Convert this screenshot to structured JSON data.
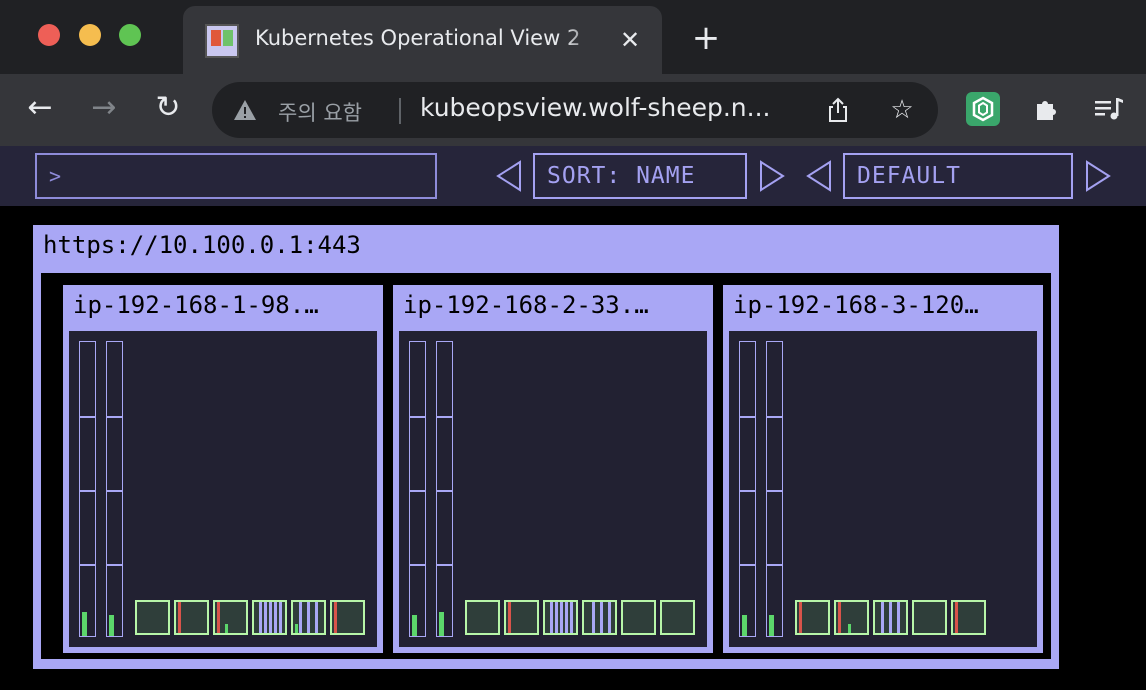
{
  "browser": {
    "tab_title": "Kubernetes Operational View 2",
    "tab_close": "✕",
    "new_tab": "+",
    "back": "←",
    "forward": "→",
    "reload": "↻",
    "security_warning": "주의 요함",
    "url": "kubeopsview.wolf-sheep.n...",
    "share_icon": "share-icon",
    "bookmark_icon": "star-icon",
    "extensions": [
      "hexagon-extension-icon",
      "puzzle-icon",
      "media-queue-icon"
    ]
  },
  "header": {
    "filter_prompt": ">",
    "sort_label": "SORT: NAME",
    "theme_label": "DEFAULT"
  },
  "cluster": {
    "api_server": "https://10.100.0.1:443",
    "nodes": [
      {
        "name": "ip-192-168-1-98.…",
        "cpu_usage": 0.08,
        "memory_usage": 0.07,
        "pods": [
          {
            "marks": []
          },
          {
            "marks": [
              {
                "c": "red",
                "x": 2
              }
            ]
          },
          {
            "marks": [
              {
                "c": "red",
                "x": 2
              },
              {
                "c": "grn",
                "x": 10,
                "h": 0.3
              }
            ]
          },
          {
            "marks": [
              {
                "c": "lav",
                "x": 5
              },
              {
                "c": "lav",
                "x": 10
              },
              {
                "c": "lav",
                "x": 15
              },
              {
                "c": "lav",
                "x": 20
              },
              {
                "c": "lav",
                "x": 25
              }
            ]
          },
          {
            "marks": [
              {
                "c": "lav",
                "x": 6
              },
              {
                "c": "lav",
                "x": 14
              },
              {
                "c": "lav",
                "x": 22
              },
              {
                "c": "grn",
                "x": 2,
                "h": 0.3
              }
            ]
          },
          {
            "marks": [
              {
                "c": "red",
                "x": 2
              }
            ]
          }
        ]
      },
      {
        "name": "ip-192-168-2-33.…",
        "cpu_usage": 0.07,
        "memory_usage": 0.08,
        "pods": [
          {
            "marks": []
          },
          {
            "marks": [
              {
                "c": "red",
                "x": 2
              }
            ]
          },
          {
            "marks": [
              {
                "c": "lav",
                "x": 5
              },
              {
                "c": "lav",
                "x": 10
              },
              {
                "c": "lav",
                "x": 15
              },
              {
                "c": "lav",
                "x": 20
              },
              {
                "c": "lav",
                "x": 25
              }
            ]
          },
          {
            "marks": [
              {
                "c": "lav",
                "x": 8
              },
              {
                "c": "lav",
                "x": 16
              },
              {
                "c": "lav",
                "x": 24
              }
            ]
          },
          {
            "marks": []
          },
          {
            "marks": []
          }
        ]
      },
      {
        "name": "ip-192-168-3-120…",
        "cpu_usage": 0.07,
        "memory_usage": 0.07,
        "pods": [
          {
            "marks": [
              {
                "c": "red",
                "x": 2
              }
            ]
          },
          {
            "marks": [
              {
                "c": "red",
                "x": 2
              },
              {
                "c": "grn",
                "x": 12,
                "h": 0.3
              }
            ]
          },
          {
            "marks": [
              {
                "c": "lav",
                "x": 6
              },
              {
                "c": "lav",
                "x": 14
              },
              {
                "c": "lav",
                "x": 22
              }
            ]
          },
          {
            "marks": []
          },
          {
            "marks": [
              {
                "c": "red",
                "x": 2
              }
            ]
          }
        ]
      }
    ]
  },
  "colors": {
    "accent": "#a9a7f5",
    "pod_border": "#b7f5a8",
    "usage_fill": "#5cd66b",
    "warning": "#d9544a"
  }
}
